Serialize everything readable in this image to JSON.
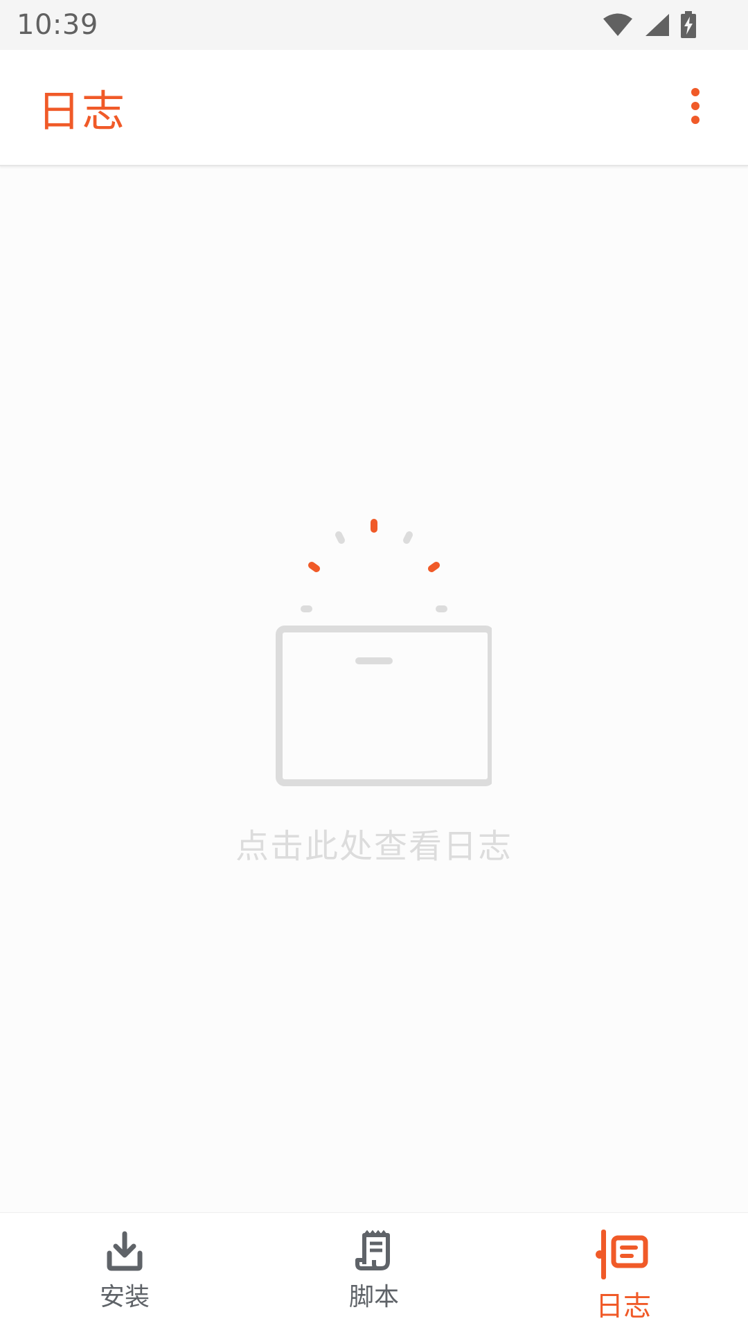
{
  "status_bar": {
    "time": "10:39",
    "icons": [
      "wifi-icon",
      "cell-signal-icon",
      "battery-charging-icon"
    ]
  },
  "app_bar": {
    "title": "日志",
    "menu_icon": "more-vert-icon"
  },
  "empty_state": {
    "illustration": "empty-box-icon",
    "text": "点击此处查看日志"
  },
  "bottom_nav": {
    "items": [
      {
        "label": "安装",
        "icon": "download-tray-icon",
        "active": false
      },
      {
        "label": "脚本",
        "icon": "script-scroll-icon",
        "active": false
      },
      {
        "label": "日志",
        "icon": "log-icon",
        "active": true
      }
    ]
  },
  "colors": {
    "accent": "#f05a28",
    "inactive": "#5f6368",
    "empty_gray": "#dcdcdc",
    "background": "#fcfcfc"
  }
}
